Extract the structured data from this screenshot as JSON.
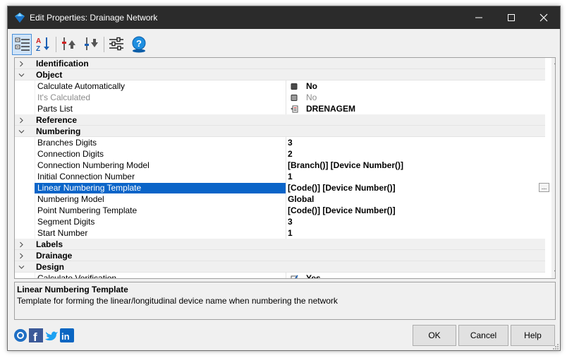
{
  "window": {
    "title": "Edit Properties: Drainage Network"
  },
  "toolbar": {
    "buttons": [
      {
        "icon": "categorized-view-icon"
      },
      {
        "icon": "sort-az-icon"
      },
      {
        "icon": "move-up-icon"
      },
      {
        "icon": "move-down-icon"
      },
      {
        "icon": "settings-sliders-icon"
      },
      {
        "icon": "help-icon"
      }
    ]
  },
  "grid": {
    "rows": [
      {
        "type": "cat",
        "label": "Identification",
        "expanded": false
      },
      {
        "type": "cat",
        "label": "Object",
        "expanded": true
      },
      {
        "type": "prop",
        "label": "Calculate Automatically",
        "value": "No",
        "value_icon": "checkbox-icon"
      },
      {
        "type": "prop",
        "label": "It's Calculated",
        "value": "No",
        "value_icon": "checkbox-icon",
        "disabled": true
      },
      {
        "type": "prop",
        "label": "Parts List",
        "value": "DRENAGEM",
        "value_icon": "parts-list-icon"
      },
      {
        "type": "cat",
        "label": "Reference",
        "expanded": false
      },
      {
        "type": "cat",
        "label": "Numbering",
        "expanded": true
      },
      {
        "type": "prop",
        "label": "Branches Digits",
        "value": "3"
      },
      {
        "type": "prop",
        "label": "Connection Digits",
        "value": "2"
      },
      {
        "type": "prop",
        "label": "Connection Numbering Model",
        "value": "[Branch()] [Device Number()]"
      },
      {
        "type": "prop",
        "label": "Initial Connection Number",
        "value": "1"
      },
      {
        "type": "prop",
        "label": "Linear Numbering Template",
        "value": "[Code()] [Device Number()]",
        "selected": true,
        "ellipsis": "..."
      },
      {
        "type": "prop",
        "label": "Numbering Model",
        "value": "Global"
      },
      {
        "type": "prop",
        "label": "Point Numbering Template",
        "value": "[Code()] [Device Number()]"
      },
      {
        "type": "prop",
        "label": "Segment Digits",
        "value": "3"
      },
      {
        "type": "prop",
        "label": "Start Number",
        "value": "1"
      },
      {
        "type": "cat",
        "label": "Labels",
        "expanded": false
      },
      {
        "type": "cat",
        "label": "Drainage",
        "expanded": false
      },
      {
        "type": "cat",
        "label": "Design",
        "expanded": true
      },
      {
        "type": "prop",
        "label": "Calculate Verification",
        "value": "Yes",
        "value_icon": "checkbox-checked-icon"
      }
    ]
  },
  "description": {
    "title": "Linear Numbering Template",
    "text": "Template for forming the linear/longitudinal device name when numbering the network"
  },
  "social": [
    "app-logo-icon",
    "facebook-icon",
    "twitter-icon",
    "linkedin-icon"
  ],
  "buttons": {
    "ok": "OK",
    "cancel": "Cancel",
    "help": "Help"
  },
  "colors": {
    "titlebar": "#2b2b2b",
    "selection": "#0a64c8",
    "category_bg": "#f0f0f0"
  }
}
